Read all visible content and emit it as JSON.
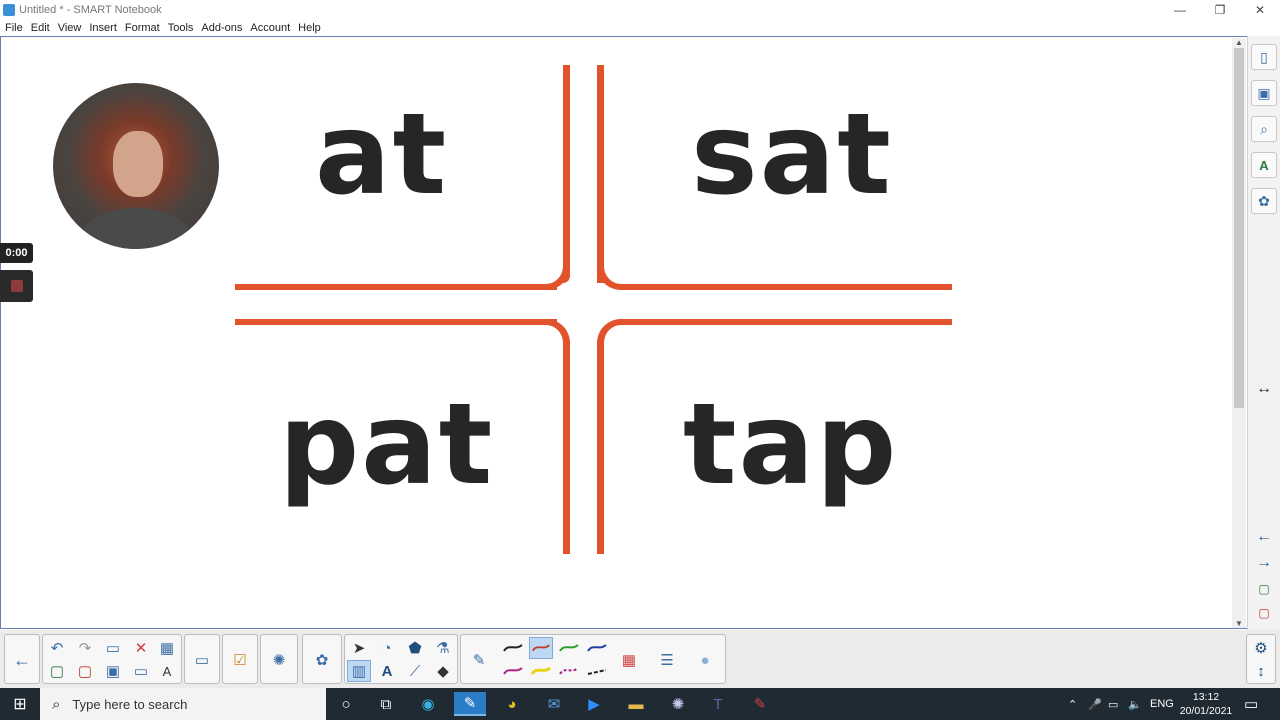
{
  "window": {
    "title": "Untitled * - SMART Notebook",
    "controls": [
      "—",
      "❐",
      "✕"
    ]
  },
  "menu": [
    "File",
    "Edit",
    "View",
    "Insert",
    "Format",
    "Tools",
    "Add-ons",
    "Account",
    "Help"
  ],
  "canvas": {
    "words": [
      "at",
      "sat",
      "pat",
      "tap"
    ],
    "accent_color": "#e2532b",
    "recorder": {
      "time": "0:00"
    }
  },
  "right_panel": {
    "icons": [
      "page-sorter-icon",
      "gallery-icon",
      "attachments-icon",
      "properties-icon",
      "addons-icon"
    ],
    "nav": [
      "←",
      "→"
    ]
  },
  "toolbar": {
    "groups": [
      "navigation",
      "edit",
      "response",
      "add-ons",
      "select-shape",
      "pens",
      "fill",
      "properties"
    ]
  },
  "taskbar": {
    "search_placeholder": "Type here to search",
    "time": "13:12",
    "date": "20/01/2021",
    "lang": "ENG"
  }
}
